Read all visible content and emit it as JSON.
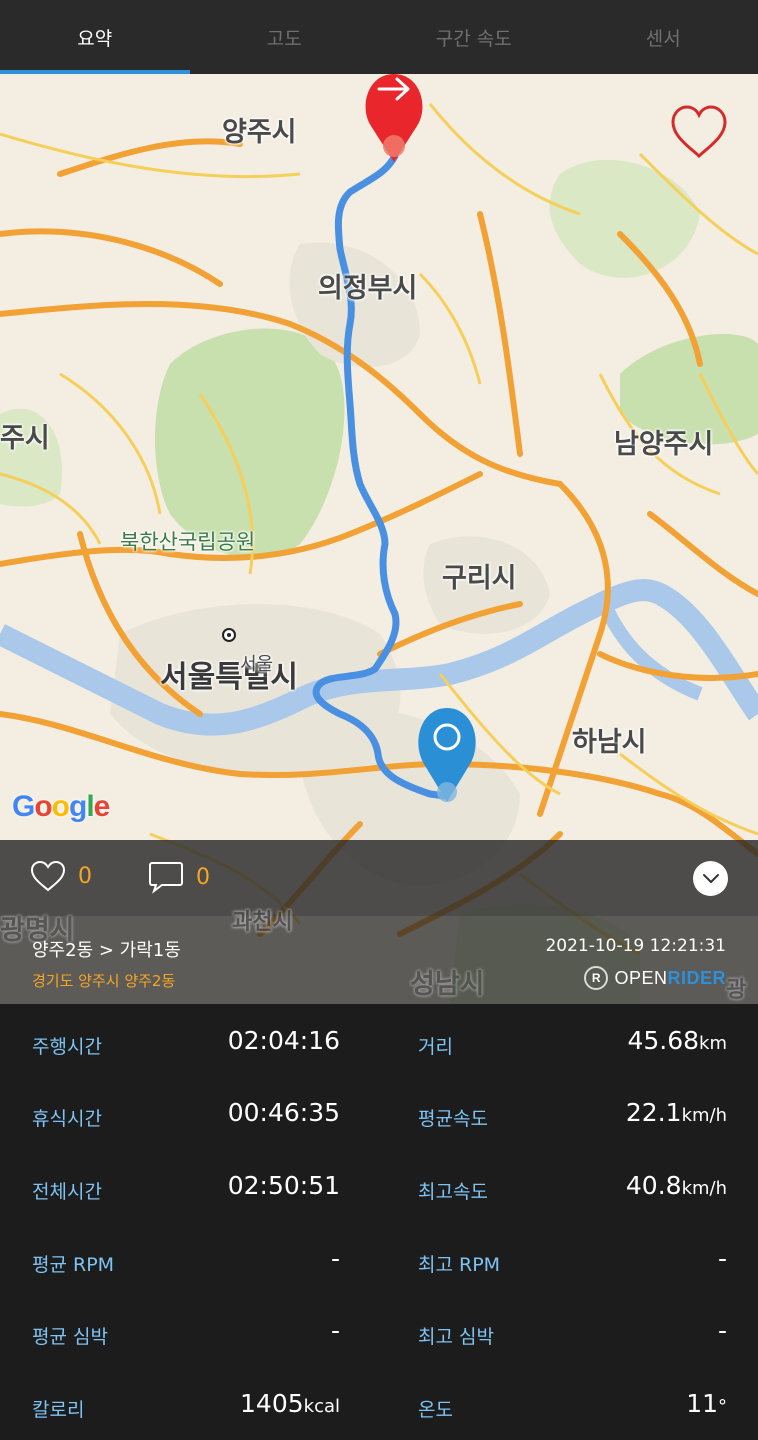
{
  "tabs": [
    {
      "label": "요약",
      "active": true
    },
    {
      "label": "고도",
      "active": false
    },
    {
      "label": "구간 속도",
      "active": false
    },
    {
      "label": "센서",
      "active": false
    }
  ],
  "map": {
    "labels": {
      "yangju": "양주시",
      "uijeongbu": "의정부시",
      "namyangju": "남양주시",
      "bukhansan": "북한산국립공원",
      "guri": "구리시",
      "seoul": "서울특별시",
      "seoul_point": "서울",
      "hanam": "하남시",
      "goyang_partial": "주시",
      "gwangmyeong": "광명시",
      "gwacheon": "과천시",
      "seongnam": "성남시",
      "gwang_partial": "광"
    },
    "attribution": "Google",
    "route_color": "#4a90e2",
    "start_marker_color": "#e8262c",
    "end_marker_color": "#2a8fd4"
  },
  "social": {
    "likes": "0",
    "comments": "0"
  },
  "route": {
    "title": "양주2동 > 가락1동",
    "subtitle": "경기도 양주시 양주2동",
    "datetime": "2021-10-19 12:21:31",
    "brand_open": "OPEN",
    "brand_rider": "RIDER"
  },
  "stats": {
    "ride_time": {
      "label": "주행시간",
      "value": "02:04:16",
      "unit": ""
    },
    "distance": {
      "label": "거리",
      "value": "45.68",
      "unit": "km"
    },
    "rest_time": {
      "label": "휴식시간",
      "value": "00:46:35",
      "unit": ""
    },
    "avg_speed": {
      "label": "평균속도",
      "value": "22.1",
      "unit": "km/h"
    },
    "total_time": {
      "label": "전체시간",
      "value": "02:50:51",
      "unit": ""
    },
    "max_speed": {
      "label": "최고속도",
      "value": "40.8",
      "unit": "km/h"
    },
    "avg_rpm": {
      "label": "평균 RPM",
      "value": "-",
      "unit": ""
    },
    "max_rpm": {
      "label": "최고 RPM",
      "value": "-",
      "unit": ""
    },
    "avg_hr": {
      "label": "평균 심박",
      "value": "-",
      "unit": ""
    },
    "max_hr": {
      "label": "최고 심박",
      "value": "-",
      "unit": ""
    },
    "calories": {
      "label": "칼로리",
      "value": "1405",
      "unit": "kcal"
    },
    "temperature": {
      "label": "온도",
      "value": "11",
      "unit": "°"
    }
  },
  "colors": {
    "accent": "#2f8fd8",
    "label_blue": "#7ec3f2",
    "orange": "#f5a623"
  }
}
